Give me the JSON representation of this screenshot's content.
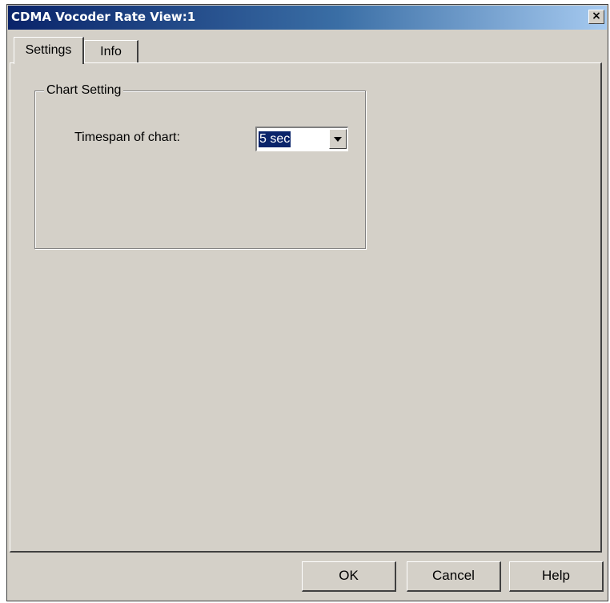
{
  "window": {
    "title": "CDMA Vocoder Rate View:1",
    "close_glyph": "×"
  },
  "tabs": [
    {
      "label": "Settings",
      "active": true
    },
    {
      "label": "Info",
      "active": false
    }
  ],
  "chart_setting": {
    "group_label": "Chart Setting",
    "timespan_label": "Timespan of chart:",
    "timespan_value": "5 sec"
  },
  "buttons": {
    "ok": "OK",
    "cancel": "Cancel",
    "help": "Help"
  }
}
